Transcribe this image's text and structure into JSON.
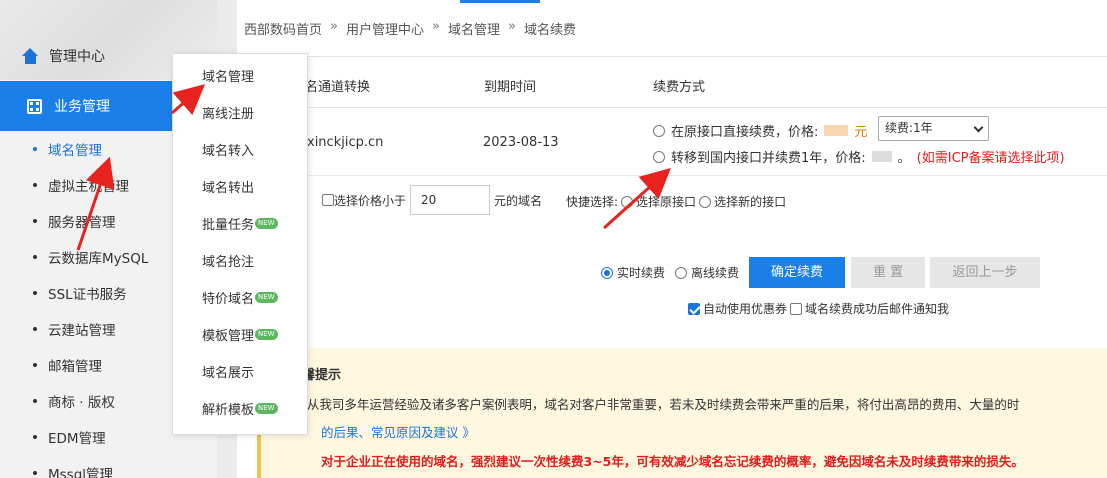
{
  "sidebar": {
    "header": "管理中心",
    "section": "业务管理",
    "items": [
      {
        "label": "域名管理"
      },
      {
        "label": "虚拟主机管理"
      },
      {
        "label": "服务器管理"
      },
      {
        "label": "云数据库MySQL"
      },
      {
        "label": "SSL证书服务"
      },
      {
        "label": "云建站管理"
      },
      {
        "label": "邮箱管理"
      },
      {
        "label": "商标 · 版权"
      },
      {
        "label": "EDM管理"
      },
      {
        "label": "Mssql管理"
      }
    ]
  },
  "submenu": {
    "items": [
      {
        "label": "域名管理",
        "badge": ""
      },
      {
        "label": "离线注册",
        "badge": ""
      },
      {
        "label": "域名转入",
        "badge": ""
      },
      {
        "label": "域名转出",
        "badge": ""
      },
      {
        "label": "批量任务",
        "badge": "NEW"
      },
      {
        "label": "域名抢注",
        "badge": ""
      },
      {
        "label": "特价域名",
        "badge": "NEW"
      },
      {
        "label": "模板管理",
        "badge": "NEW"
      },
      {
        "label": "域名展示",
        "badge": ""
      },
      {
        "label": "解析模板",
        "badge": "NEW"
      }
    ]
  },
  "breadcrumb": {
    "home": "西部数码首页",
    "user": "用户管理中心",
    "domain": "域名管理",
    "current": "域名续费",
    "sep": "»"
  },
  "table": {
    "headers": {
      "channel": "名通道转换",
      "expire": "到期时间",
      "method": "续费方式"
    },
    "row": {
      "domain": "xinckjicp.cn",
      "expire": "2023-08-13",
      "option1": "在原接口直接续费，价格:",
      "option1_unit": "元",
      "select_value": "续费:1年",
      "option2": "转移到国内接口并续费1年，价格:",
      "option2_suffix": "。",
      "option2_note": "(如需ICP备案请选择此项)"
    }
  },
  "filter": {
    "label": "选择价格小于",
    "value": "20",
    "suffix": "元的域名",
    "quick_label": "快捷选择:",
    "quick_old": "选择原接口",
    "quick_new": "选择新的接口"
  },
  "actions": {
    "realtime": "实时续费",
    "offline": "离线续费",
    "confirm": "确定续费",
    "reset": "重 置",
    "back": "返回上一步",
    "auto_coupon": "自动使用优惠券",
    "email_notify": "域名续费成功后邮件通知我"
  },
  "tips": {
    "title": "温馨提示",
    "line1": "1. 从我司多年运营经验及诸多客户案例表明，域名对客户非常重要，若未及时续费会带来严重的后果，将付出高昂的费用、大量的时",
    "line2": "的后果、常见原因及建议 》",
    "line3": "对于企业正在使用的域名，强烈建议一次性续费3~5年，可有效减少域名忘记续费的概率，避免因域名未及时续费带来的损失。"
  },
  "colors": {
    "accent": "#1a7fe8",
    "warning_red": "#e21b1b",
    "arrow_red": "#e8231f"
  }
}
